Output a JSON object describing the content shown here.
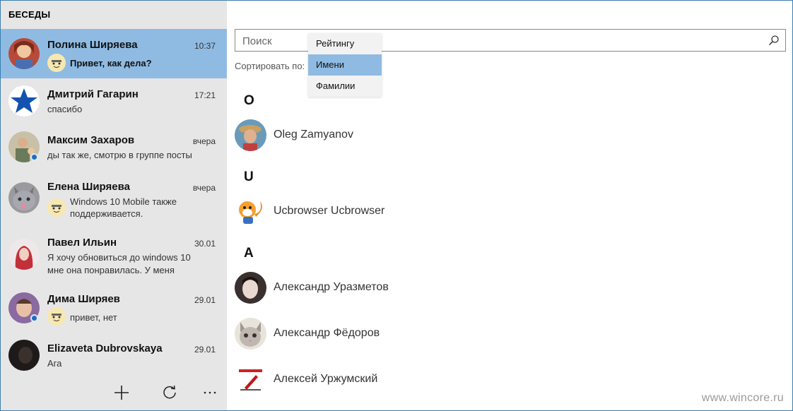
{
  "sidebar": {
    "title": "БЕСЕДЫ",
    "conversations": [
      {
        "name": "Полина Ширяева",
        "time": "10:37",
        "message": "Привет, как дела?",
        "active": true,
        "emoji": true
      },
      {
        "name": "Дмитрий Гагарин",
        "time": "17:21",
        "message": "спасибо",
        "active": false,
        "emoji": false
      },
      {
        "name": "Максим Захаров",
        "time": "вчера",
        "message": "ды так же, смотрю в группе посты",
        "active": false,
        "emoji": false,
        "online": true
      },
      {
        "name": "Елена Ширяева",
        "time": "вчера",
        "message_line1": "Windows 10 Mobile также",
        "message_line2": "поддерживается.",
        "active": false,
        "emoji": true
      },
      {
        "name": "Павел Ильин",
        "time": "30.01",
        "message_line1": "Я хочу обновиться до windows 10",
        "message_line2": "мне она понравилась. У меня",
        "active": false,
        "emoji": false
      },
      {
        "name": "Дима Ширяев",
        "time": "29.01",
        "message": "привет, нет",
        "active": false,
        "emoji": true,
        "online": true
      },
      {
        "name": "Elizaveta Dubrovskaya",
        "time": "29.01",
        "message": "Ага",
        "active": false,
        "emoji": false
      }
    ],
    "toolbar": {
      "add_icon": "plus-icon",
      "refresh_icon": "refresh-icon",
      "more_icon": "more-icon"
    }
  },
  "main": {
    "search": {
      "placeholder": "Поиск",
      "value": ""
    },
    "sort": {
      "label": "Сортировать по:",
      "options": [
        "Рейтингу",
        "Имени",
        "Фамилии"
      ],
      "selected": "Имени"
    },
    "sections": [
      {
        "letter": "O",
        "contacts": [
          "Oleg Zamyanov"
        ]
      },
      {
        "letter": "U",
        "contacts": [
          "Ucbrowser Ucbrowser"
        ]
      },
      {
        "letter": "А",
        "contacts": [
          "Александр Уразметов",
          "Александр Фёдоров",
          "Алексей Уржумский"
        ]
      }
    ]
  },
  "watermark": "www.wincore.ru",
  "colors": {
    "accent": "#8fbbe3",
    "sidebar_bg": "#e6e6e6",
    "presence": "#1570c8"
  }
}
